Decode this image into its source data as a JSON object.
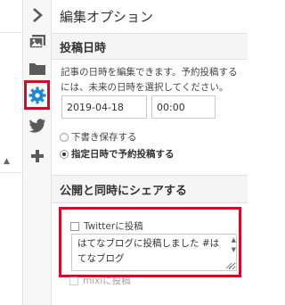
{
  "panel": {
    "title": "編集オプション"
  },
  "icons": {
    "collapse": "chevron-right-icon",
    "image": "image-gallery-icon",
    "folder": "folder-icon",
    "settings": "gear-icon",
    "twitter": "twitter-icon",
    "add": "plus-icon"
  },
  "datetime_section": {
    "heading": "投稿日時",
    "description": "記事の日時を編集できます。予約投稿するには、未来の日時を選択してください。",
    "date_value": "2019-04-18",
    "time_value": "00:00",
    "options": [
      {
        "label": "下書き保存する",
        "checked": false
      },
      {
        "label": "指定日時で予約投稿する",
        "checked": true
      }
    ]
  },
  "share_section": {
    "heading": "公開と同時にシェアする",
    "twitter_label": "Twitterに投稿",
    "twitter_checked": false,
    "twitter_text": "はてなブログに投稿しました #はてなブログ",
    "mixi_label": "mixiに投稿",
    "mixi_checked": false
  },
  "colors": {
    "accent": "#1e88d2",
    "highlight": "#c8102e",
    "icon_gray": "#5a5a5a"
  }
}
